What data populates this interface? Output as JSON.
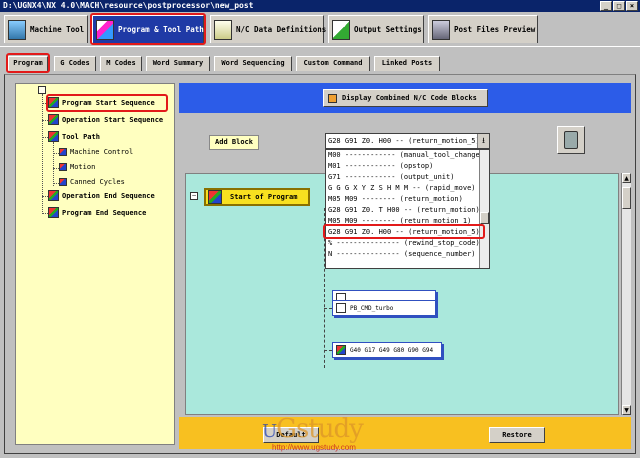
{
  "window": {
    "title": "D:\\UGNX4\\NX 4.0\\MACH\\resource\\postprocessor\\new_post",
    "controls": [
      "_",
      "□",
      "×"
    ]
  },
  "main_tabs": [
    {
      "label": "Machine Tool",
      "icon": "machine-tool-icon"
    },
    {
      "label": "Program & Tool Path",
      "icon": "program-tool-path-icon"
    },
    {
      "label": "N/C Data Definitions",
      "icon": "nc-data-icon"
    },
    {
      "label": "Output Settings",
      "icon": "output-settings-icon"
    },
    {
      "label": "Post Files Preview",
      "icon": "printer-icon"
    }
  ],
  "sub_tabs": [
    "Program",
    "G Codes",
    "M Codes",
    "Word Summary",
    "Word Sequencing",
    "Custom Command",
    "Linked Posts"
  ],
  "tree": [
    {
      "label": "Program Start Sequence",
      "level": 0
    },
    {
      "label": "Operation Start Sequence",
      "level": 0
    },
    {
      "label": "Tool Path",
      "level": 0
    },
    {
      "label": "Machine Control",
      "level": 1
    },
    {
      "label": "Motion",
      "level": 1
    },
    {
      "label": "Canned Cycles",
      "level": 1
    },
    {
      "label": "Operation End Sequence",
      "level": 0
    },
    {
      "label": "Program End Sequence",
      "level": 0
    }
  ],
  "display_button": "Display Combined N/C Code Blocks",
  "add_block_button": "Add Block",
  "combo_value": "G28 G91 Z0. H00 -- (return_motion_5)",
  "dropdown_items": [
    "M00 ------------ (manual_tool_change)",
    "M01 ------------ (opstop)",
    "G71 ------------ (output_unit)",
    "G G G X Y Z S H M M -- (rapid_move)",
    "M05 M09 -------- (return_motion)",
    "G28 G91 Z0. T H00 -- (return_motion)",
    "M05 M09 -------- (return_motion_1)",
    "G28 G91 Z0. H00 -- (return_motion_5)",
    "% --------------- (rewind_stop_code)",
    "N --------------- (sequence_number)"
  ],
  "canvas": {
    "start_block": "Start of Program",
    "blocks": [
      "PB_CMD_turbo",
      "G40 G17 G49 G80 G90 G94"
    ]
  },
  "bottom_buttons": [
    "Default",
    "Restore"
  ],
  "watermark": {
    "logo_u": "U",
    "logo_rest": "Gstudy",
    "url": "http://www.ugstudy.com"
  }
}
